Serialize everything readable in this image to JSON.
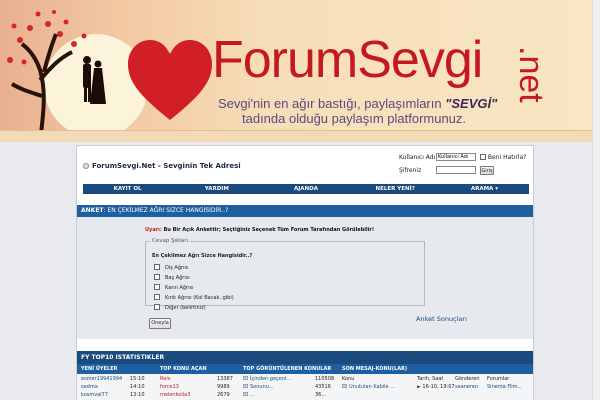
{
  "banner": {
    "logo_main": "ForumSevgi",
    "logo_suffix": ".net",
    "tagline_line1_a": "Sevgi'nin en ağır bastığı, paylaşımların ",
    "tagline_line1_b": "\"SEVGİ\"",
    "tagline_line2": "tadında olduğu paylaşım platformunuz.",
    "colors": {
      "brand_red": "#c41a1f",
      "tag_purple": "#5a4a7a"
    }
  },
  "header": {
    "site_title": "ForumSevgi.Net - Sevginin Tek Adresi",
    "login": {
      "username_label": "Kullanıcı Adı",
      "username_value": "Kullanıcı Adı",
      "remember_label": "Beni Hatırla?",
      "password_label": "Şifreniz",
      "login_button": "Giriş"
    }
  },
  "nav": {
    "items": [
      "KAYIT OL",
      "YARDIM",
      "AJANDA",
      "NELER YENİ?",
      "ARAMA ▾"
    ],
    "color": "#1b4a7e"
  },
  "poll": {
    "header_label": "ANKET",
    "header_title": ": EN ÇEKİLMEZ AĞRI SİZCE HANGİSİDİR..?",
    "warning_label": "Uyarı:",
    "warning_text": "Bu Bir Açık Ankettir; Seçtiğiniz Seçenek Tüm Forum Tarafından Görülebilir!",
    "legend": "Cevap Şıkları",
    "question": "En Çekilmez Ağrı Sizce Hangisidir..?",
    "options": [
      "Diş Ağrısı",
      "Baş Ağrısı",
      "Karın Ağrısı",
      "Kırık Ağrısı (Kol Bacak..gibi)",
      "Diğer (belirtiniz)"
    ],
    "vote_button": "Oneyla",
    "results_link": "Anket Sonuçları"
  },
  "stats": {
    "title": "FY TOP10 ISTATISTIKLER",
    "columns": [
      "YENİ ÜYELER",
      "TOP KONU AÇAN",
      "TOP GÖRÜNTÜLENEN KONULAR",
      "SON MESAJ-KONU(LAR)"
    ],
    "new_members": [
      {
        "name": "esmer19941994",
        "date": "15-10"
      },
      {
        "name": "sedma",
        "date": "14-10"
      },
      {
        "name": "kosmval77",
        "date": "13-10"
      }
    ],
    "top_posters": [
      {
        "name": "Reis",
        "count": "13387"
      },
      {
        "name": "force13",
        "count": "9989"
      },
      {
        "name": "melenkolia3",
        "count": "2679"
      }
    ],
    "top_viewed": [
      {
        "title": "İçinden geçeni...",
        "views": "110508"
      },
      {
        "title": "Sonunu...",
        "views": "43516"
      },
      {
        "title": "...",
        "views": "36..."
      }
    ],
    "recent_headers": {
      "topic": "Konu",
      "datetime": "Tarih, Saat",
      "sender": "Gönderen",
      "forums": "Forumlar"
    },
    "recent_rows": [
      {
        "topic": "Unutulan Kabile ...",
        "datetime": "16-10, 19:07",
        "sender": "seaneren",
        "forum": "Sinema Film..."
      }
    ]
  }
}
